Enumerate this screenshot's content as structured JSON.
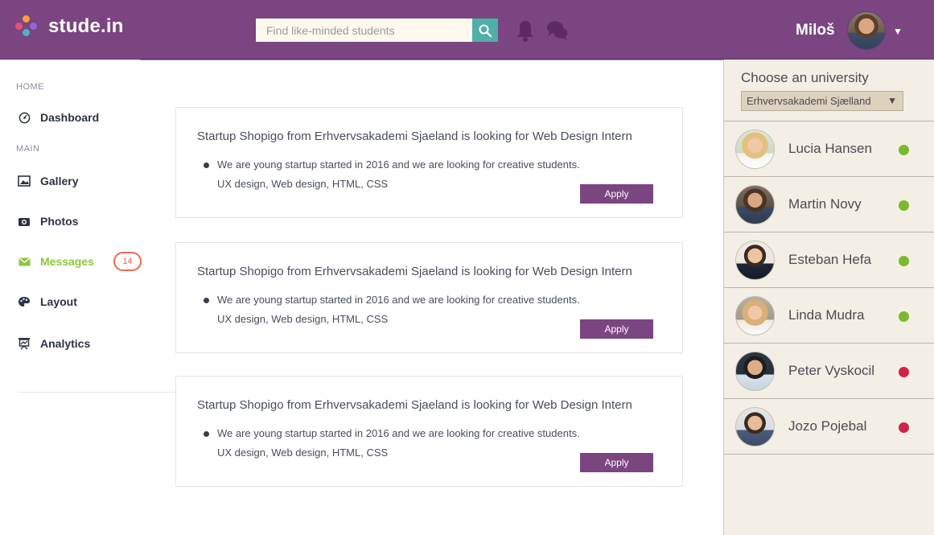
{
  "app": {
    "logo_text": "stude.in"
  },
  "header": {
    "search_placeholder": "Find like-minded students",
    "user_name": "Miloš",
    "user_caret": "▼"
  },
  "sidebar": {
    "home_heading": "HOME",
    "main_heading": "MAIN",
    "items": [
      {
        "label": "Dashboard",
        "icon": "dashboard-icon"
      },
      {
        "label": "Gallery",
        "icon": "gallery-icon"
      },
      {
        "label": "Photos",
        "icon": "camera-icon"
      },
      {
        "label": "Messages",
        "icon": "envelope-icon",
        "badge": "14",
        "active": true
      },
      {
        "label": "Layout",
        "icon": "palette-icon"
      },
      {
        "label": "Analytics",
        "icon": "presentation-icon"
      }
    ]
  },
  "posts": [
    {
      "title": "Startup Shopigo from Erhvervsakademi Sjaeland is looking for Web Design Intern",
      "description": "We are young startup started in 2016 and we are looking for creative students.",
      "tags": "UX design, Web design, HTML, CSS",
      "button": "Apply"
    },
    {
      "title": "Startup Shopigo from Erhvervsakademi Sjaeland is looking for Web Design Intern",
      "description": "We are young startup started in 2016 and we are looking for creative students.",
      "tags": "UX design, Web design, HTML, CSS",
      "button": "Apply"
    },
    {
      "title": "Startup Shopigo from Erhvervsakademi Sjaeland is looking for Web Design Intern",
      "description": "We are young startup started in 2016 and we are looking for creative students.",
      "tags": "UX design, Web design, HTML, CSS",
      "button": "Apply"
    }
  ],
  "university": {
    "title": "Choose an university",
    "selected": "Erhvervsakademi Sjælland",
    "caret": "▼"
  },
  "students": [
    {
      "name": "Lucia Hansen",
      "status": "online"
    },
    {
      "name": "Martin Novy",
      "status": "online"
    },
    {
      "name": "Esteban Hefa",
      "status": "online"
    },
    {
      "name": "Linda Mudra",
      "status": "online"
    },
    {
      "name": "Peter Vyskocil",
      "status": "offline"
    },
    {
      "name": "Jozo Pojebal",
      "status": "offline"
    }
  ],
  "colors": {
    "brand": "#7b4581",
    "accent_teal": "#4fb0a5",
    "active_green": "#8dc63f",
    "badge_red": "#ec6a4c",
    "online": "#7cb82f",
    "offline": "#d0234a"
  }
}
